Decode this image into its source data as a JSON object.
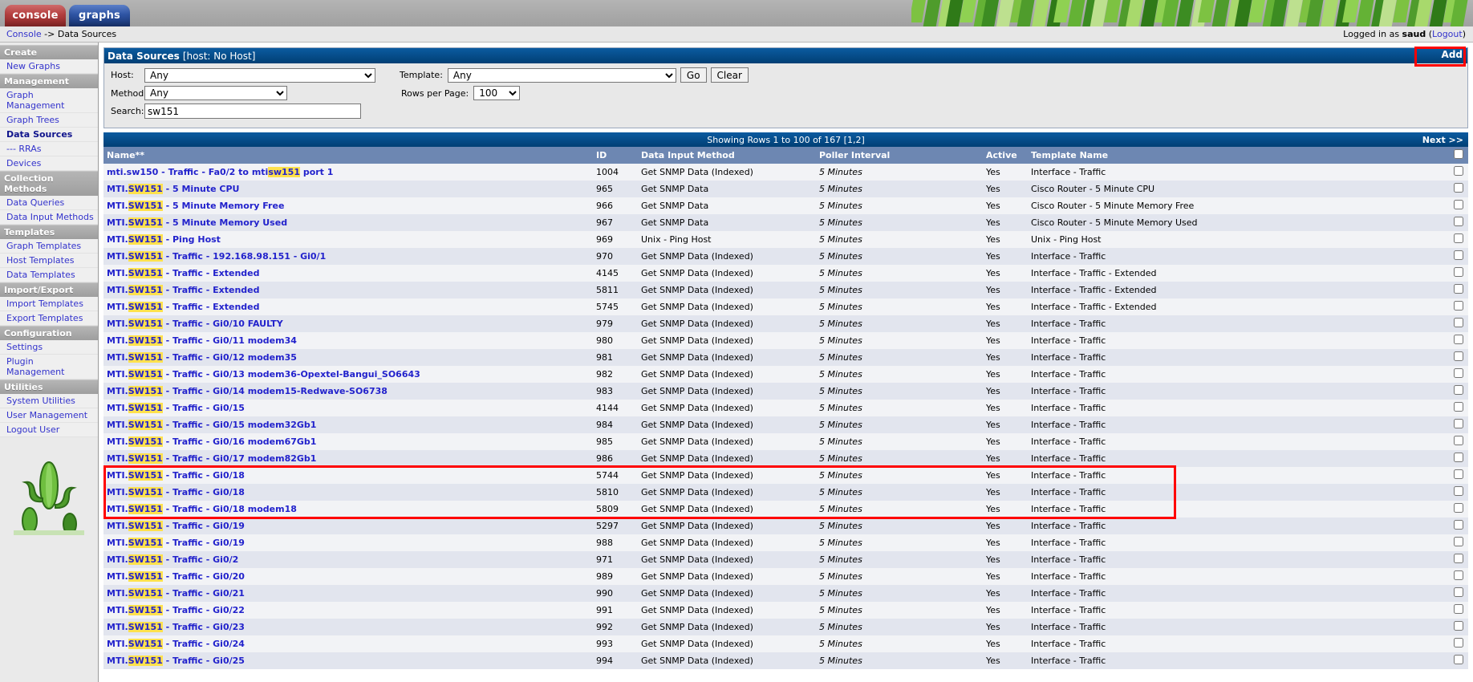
{
  "tabs": [
    {
      "id": "console",
      "label": "console",
      "active": false
    },
    {
      "id": "graphs",
      "label": "graphs",
      "active": true
    }
  ],
  "breadcrumb": {
    "root": "Console",
    "arrow": "->",
    "current": "Data Sources"
  },
  "login": {
    "prefix": "Logged in as",
    "user": "saud",
    "logout_open": "(",
    "logout": "Logout",
    "logout_close": ")"
  },
  "sidebar": {
    "sections": [
      {
        "header": "Create",
        "items": [
          {
            "label": "New Graphs",
            "current": false
          }
        ]
      },
      {
        "header": "Management",
        "items": [
          {
            "label": "Graph Management",
            "current": false
          },
          {
            "label": "Graph Trees",
            "current": false
          },
          {
            "label": "Data Sources",
            "current": true
          },
          {
            "label": "--- RRAs",
            "current": false
          },
          {
            "label": "Devices",
            "current": false
          }
        ]
      },
      {
        "header": "Collection Methods",
        "items": [
          {
            "label": "Data Queries",
            "current": false
          },
          {
            "label": "Data Input Methods",
            "current": false
          }
        ]
      },
      {
        "header": "Templates",
        "items": [
          {
            "label": "Graph Templates",
            "current": false
          },
          {
            "label": "Host Templates",
            "current": false
          },
          {
            "label": "Data Templates",
            "current": false
          }
        ]
      },
      {
        "header": "Import/Export",
        "items": [
          {
            "label": "Import Templates",
            "current": false
          },
          {
            "label": "Export Templates",
            "current": false
          }
        ]
      },
      {
        "header": "Configuration",
        "items": [
          {
            "label": "Settings",
            "current": false
          },
          {
            "label": "Plugin Management",
            "current": false
          }
        ]
      },
      {
        "header": "Utilities",
        "items": [
          {
            "label": "System Utilities",
            "current": false
          },
          {
            "label": "User Management",
            "current": false
          },
          {
            "label": "Logout User",
            "current": false
          }
        ]
      }
    ],
    "logo": "cactus-logo"
  },
  "panel": {
    "title_main": "Data Sources",
    "title_sub": "[host: No Host]",
    "add_label": "Add",
    "add_annotated": true
  },
  "filter": {
    "host_label": "Host:",
    "host_value": "Any",
    "method_label": "Method:",
    "method_value": "Any",
    "search_label": "Search:",
    "search_value": "sw151",
    "search_placeholder": "",
    "template_label": "Template:",
    "template_value": "Any",
    "rows_label": "Rows per Page:",
    "rows_value": "100",
    "go_label": "Go",
    "clear_label": "Clear",
    "options_any": [
      "Any"
    ],
    "options_rows": [
      "100"
    ]
  },
  "results": {
    "showing": "Showing Rows 1 to 100 of 167 [1,2]",
    "next_label": "Next >>",
    "headers": [
      "Name**",
      "ID",
      "Data Input Method",
      "Poller Interval",
      "Active",
      "Template Name",
      ""
    ],
    "highlight_term": "sw151",
    "annotated_rows": [
      18,
      19,
      20
    ],
    "rows": [
      {
        "name": "mti.sw150 - Traffic - Fa0/2 to mtisw151 port 1",
        "id": "1004",
        "method": "Get SNMP Data (Indexed)",
        "poller": "5 Minutes",
        "active": "Yes",
        "template": "Interface - Traffic"
      },
      {
        "name": "MTI.SW151 - 5 Minute CPU",
        "id": "965",
        "method": "Get SNMP Data",
        "poller": "5 Minutes",
        "active": "Yes",
        "template": "Cisco Router - 5 Minute CPU"
      },
      {
        "name": "MTI.SW151 - 5 Minute Memory Free",
        "id": "966",
        "method": "Get SNMP Data",
        "poller": "5 Minutes",
        "active": "Yes",
        "template": "Cisco Router - 5 Minute Memory Free"
      },
      {
        "name": "MTI.SW151 - 5 Minute Memory Used",
        "id": "967",
        "method": "Get SNMP Data",
        "poller": "5 Minutes",
        "active": "Yes",
        "template": "Cisco Router - 5 Minute Memory Used"
      },
      {
        "name": "MTI.SW151 - Ping Host",
        "id": "969",
        "method": "Unix - Ping Host",
        "poller": "5 Minutes",
        "active": "Yes",
        "template": "Unix - Ping Host"
      },
      {
        "name": "MTI.SW151 - Traffic - 192.168.98.151 - Gi0/1",
        "id": "970",
        "method": "Get SNMP Data (Indexed)",
        "poller": "5 Minutes",
        "active": "Yes",
        "template": "Interface - Traffic"
      },
      {
        "name": "MTI.SW151 - Traffic - Extended",
        "id": "4145",
        "method": "Get SNMP Data (Indexed)",
        "poller": "5 Minutes",
        "active": "Yes",
        "template": "Interface - Traffic - Extended"
      },
      {
        "name": "MTI.SW151 - Traffic - Extended",
        "id": "5811",
        "method": "Get SNMP Data (Indexed)",
        "poller": "5 Minutes",
        "active": "Yes",
        "template": "Interface - Traffic - Extended"
      },
      {
        "name": "MTI.SW151 - Traffic - Extended",
        "id": "5745",
        "method": "Get SNMP Data (Indexed)",
        "poller": "5 Minutes",
        "active": "Yes",
        "template": "Interface - Traffic - Extended"
      },
      {
        "name": "MTI.SW151 - Traffic - Gi0/10 FAULTY",
        "id": "979",
        "method": "Get SNMP Data (Indexed)",
        "poller": "5 Minutes",
        "active": "Yes",
        "template": "Interface - Traffic"
      },
      {
        "name": "MTI.SW151 - Traffic - Gi0/11 modem34",
        "id": "980",
        "method": "Get SNMP Data (Indexed)",
        "poller": "5 Minutes",
        "active": "Yes",
        "template": "Interface - Traffic"
      },
      {
        "name": "MTI.SW151 - Traffic - Gi0/12 modem35",
        "id": "981",
        "method": "Get SNMP Data (Indexed)",
        "poller": "5 Minutes",
        "active": "Yes",
        "template": "Interface - Traffic"
      },
      {
        "name": "MTI.SW151 - Traffic - Gi0/13 modem36-Opextel-Bangui_SO6643",
        "id": "982",
        "method": "Get SNMP Data (Indexed)",
        "poller": "5 Minutes",
        "active": "Yes",
        "template": "Interface - Traffic"
      },
      {
        "name": "MTI.SW151 - Traffic - Gi0/14 modem15-Redwave-SO6738",
        "id": "983",
        "method": "Get SNMP Data (Indexed)",
        "poller": "5 Minutes",
        "active": "Yes",
        "template": "Interface - Traffic"
      },
      {
        "name": "MTI.SW151 - Traffic - Gi0/15",
        "id": "4144",
        "method": "Get SNMP Data (Indexed)",
        "poller": "5 Minutes",
        "active": "Yes",
        "template": "Interface - Traffic"
      },
      {
        "name": "MTI.SW151 - Traffic - Gi0/15 modem32Gb1",
        "id": "984",
        "method": "Get SNMP Data (Indexed)",
        "poller": "5 Minutes",
        "active": "Yes",
        "template": "Interface - Traffic"
      },
      {
        "name": "MTI.SW151 - Traffic - Gi0/16 modem67Gb1",
        "id": "985",
        "method": "Get SNMP Data (Indexed)",
        "poller": "5 Minutes",
        "active": "Yes",
        "template": "Interface - Traffic"
      },
      {
        "name": "MTI.SW151 - Traffic - Gi0/17 modem82Gb1",
        "id": "986",
        "method": "Get SNMP Data (Indexed)",
        "poller": "5 Minutes",
        "active": "Yes",
        "template": "Interface - Traffic"
      },
      {
        "name": "MTI.SW151 - Traffic - Gi0/18",
        "id": "5744",
        "method": "Get SNMP Data (Indexed)",
        "poller": "5 Minutes",
        "active": "Yes",
        "template": "Interface - Traffic"
      },
      {
        "name": "MTI.SW151 - Traffic - Gi0/18",
        "id": "5810",
        "method": "Get SNMP Data (Indexed)",
        "poller": "5 Minutes",
        "active": "Yes",
        "template": "Interface - Traffic"
      },
      {
        "name": "MTI.SW151 - Traffic - Gi0/18 modem18",
        "id": "5809",
        "method": "Get SNMP Data (Indexed)",
        "poller": "5 Minutes",
        "active": "Yes",
        "template": "Interface - Traffic"
      },
      {
        "name": "MTI.SW151 - Traffic - Gi0/19",
        "id": "5297",
        "method": "Get SNMP Data (Indexed)",
        "poller": "5 Minutes",
        "active": "Yes",
        "template": "Interface - Traffic"
      },
      {
        "name": "MTI.SW151 - Traffic - Gi0/19",
        "id": "988",
        "method": "Get SNMP Data (Indexed)",
        "poller": "5 Minutes",
        "active": "Yes",
        "template": "Interface - Traffic"
      },
      {
        "name": "MTI.SW151 - Traffic - Gi0/2",
        "id": "971",
        "method": "Get SNMP Data (Indexed)",
        "poller": "5 Minutes",
        "active": "Yes",
        "template": "Interface - Traffic"
      },
      {
        "name": "MTI.SW151 - Traffic - Gi0/20",
        "id": "989",
        "method": "Get SNMP Data (Indexed)",
        "poller": "5 Minutes",
        "active": "Yes",
        "template": "Interface - Traffic"
      },
      {
        "name": "MTI.SW151 - Traffic - Gi0/21",
        "id": "990",
        "method": "Get SNMP Data (Indexed)",
        "poller": "5 Minutes",
        "active": "Yes",
        "template": "Interface - Traffic"
      },
      {
        "name": "MTI.SW151 - Traffic - Gi0/22",
        "id": "991",
        "method": "Get SNMP Data (Indexed)",
        "poller": "5 Minutes",
        "active": "Yes",
        "template": "Interface - Traffic"
      },
      {
        "name": "MTI.SW151 - Traffic - Gi0/23",
        "id": "992",
        "method": "Get SNMP Data (Indexed)",
        "poller": "5 Minutes",
        "active": "Yes",
        "template": "Interface - Traffic"
      },
      {
        "name": "MTI.SW151 - Traffic - Gi0/24",
        "id": "993",
        "method": "Get SNMP Data (Indexed)",
        "poller": "5 Minutes",
        "active": "Yes",
        "template": "Interface - Traffic"
      },
      {
        "name": "MTI.SW151 - Traffic - Gi0/25",
        "id": "994",
        "method": "Get SNMP Data (Indexed)",
        "poller": "5 Minutes",
        "active": "Yes",
        "template": "Interface - Traffic"
      }
    ]
  },
  "colors": {
    "header_blue": "#014983",
    "table_header": "#6d87b2",
    "link": "#2222cc",
    "highlight": "#ffe14d",
    "annotation_red": "#ff0000"
  }
}
